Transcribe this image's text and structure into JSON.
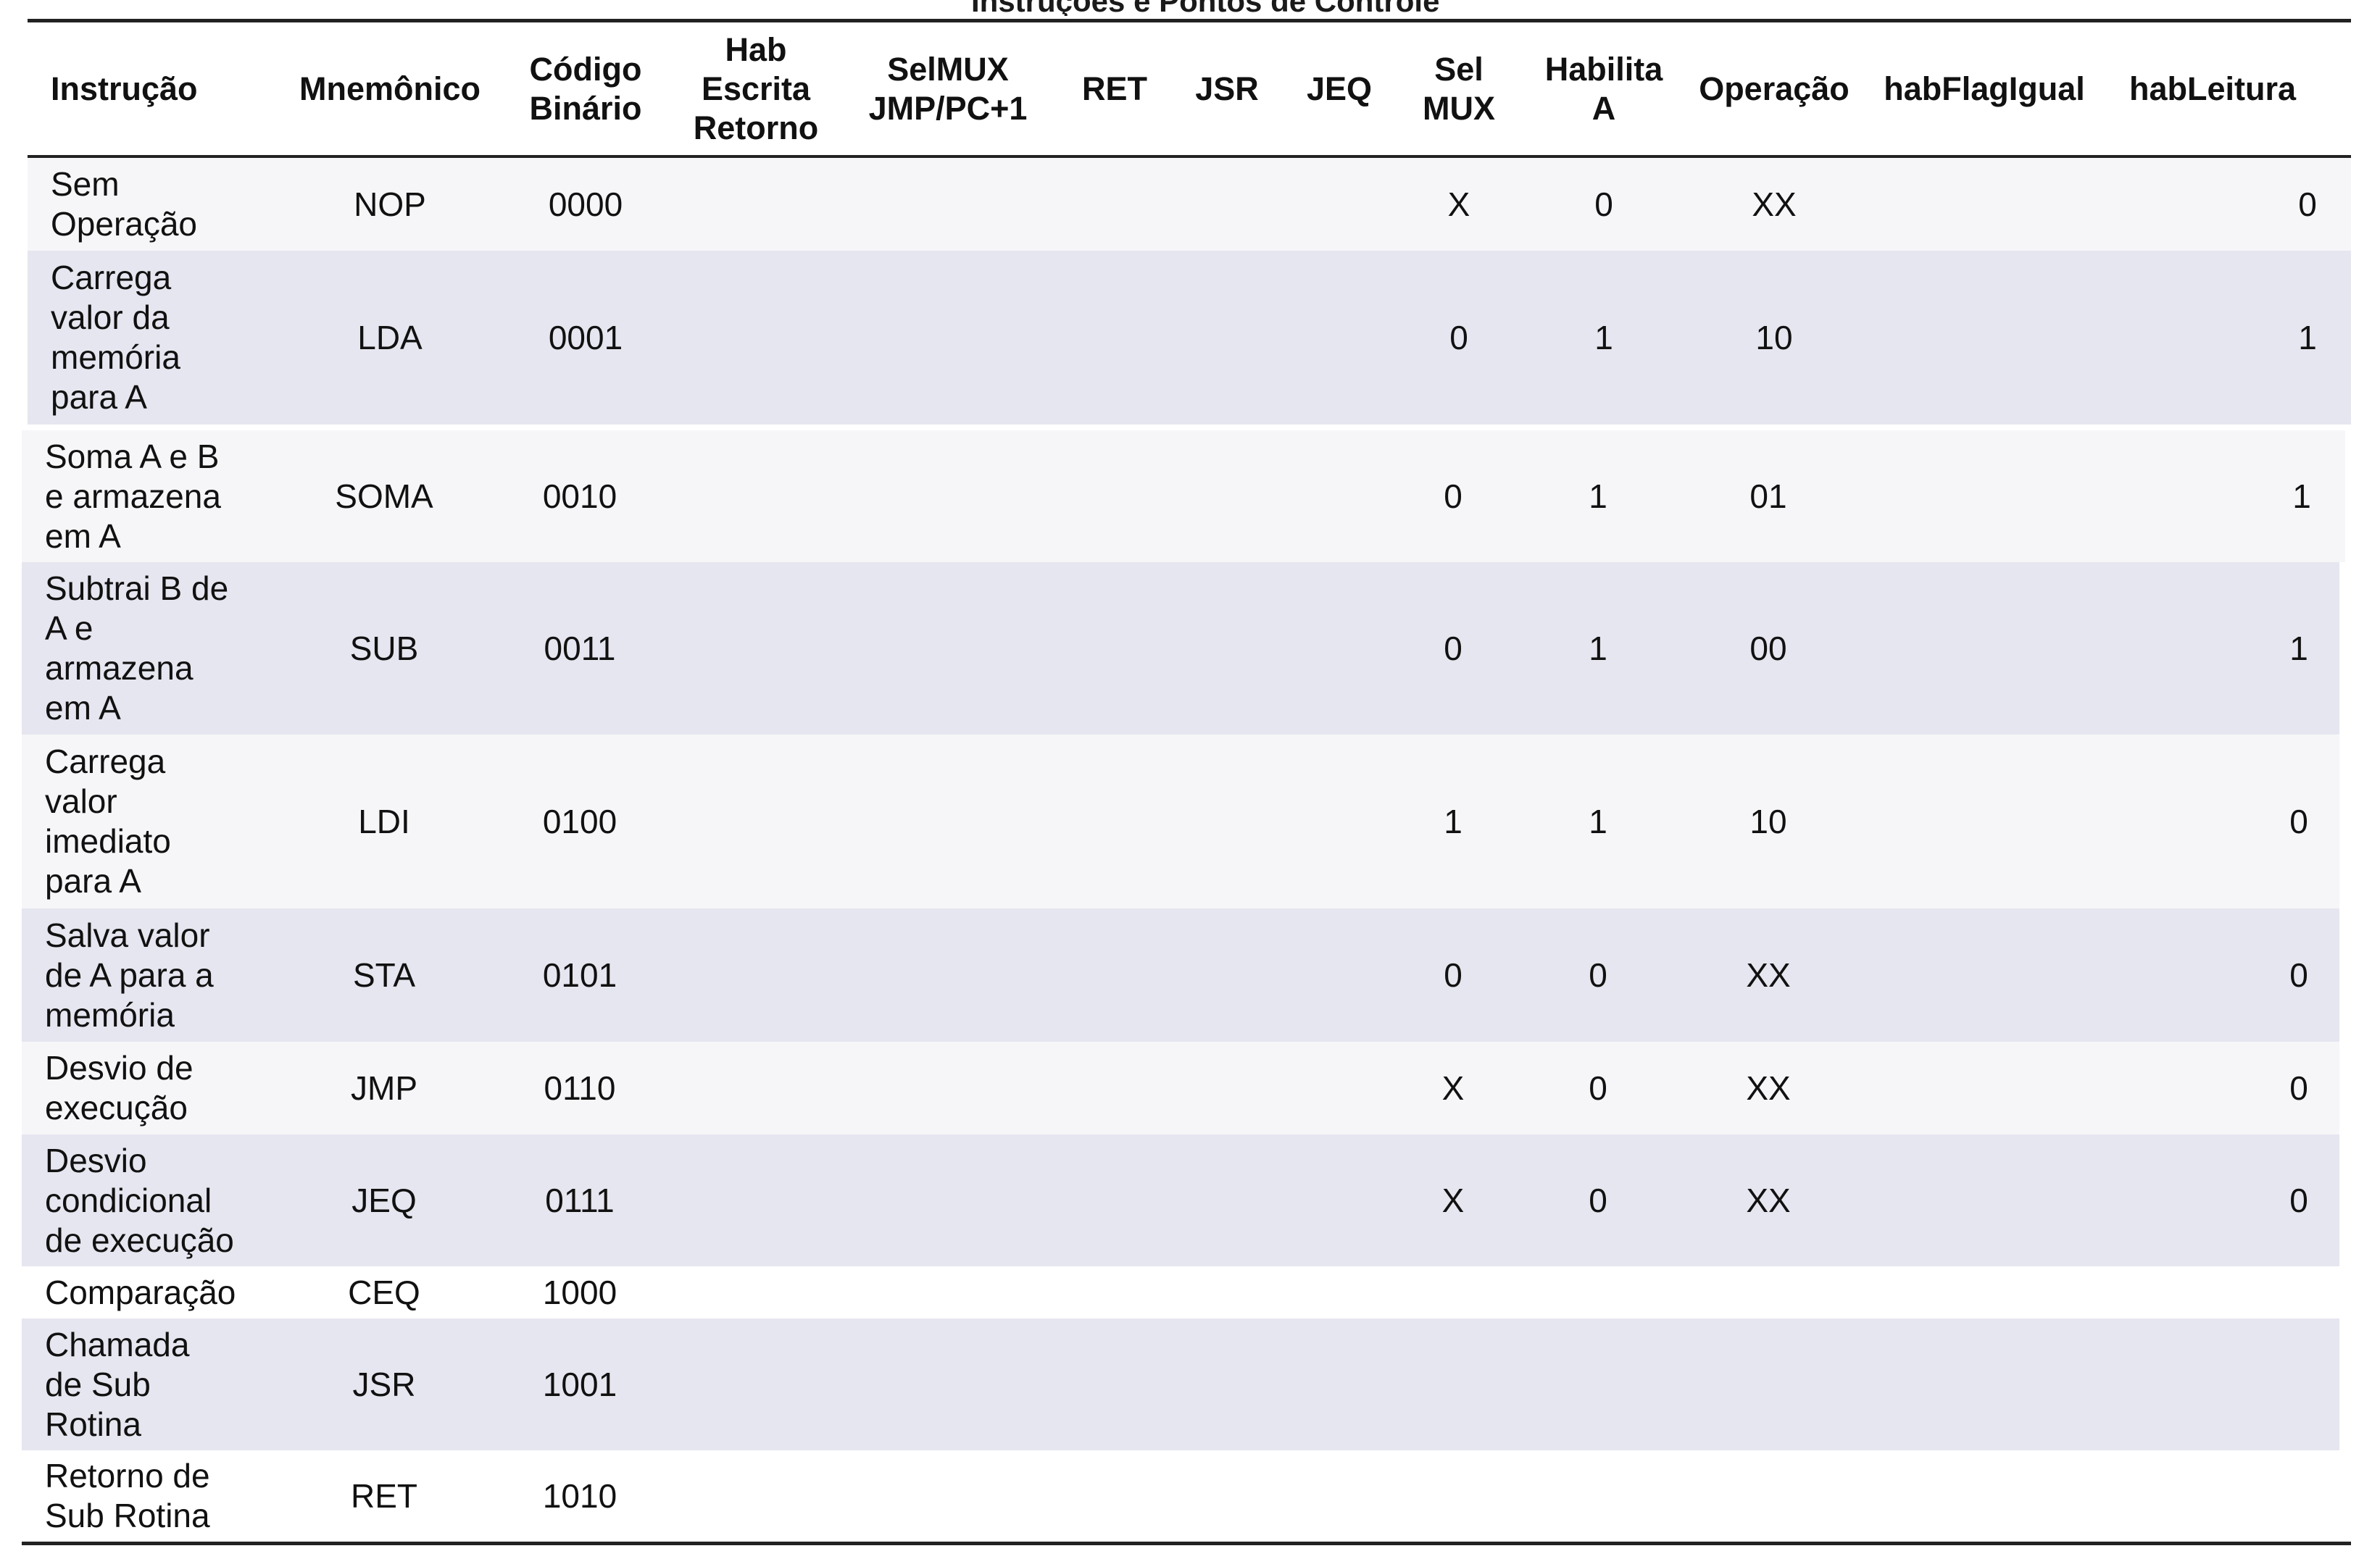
{
  "table": {
    "title": "Instruções e Pontos de Controle",
    "headers": [
      "Instrução",
      "Mnemônico",
      "Código\nBinário",
      "Hab\nEscrita\nRetorno",
      "SelMUX\nJMP/PC+1",
      "RET",
      "JSR",
      "JEQ",
      "Sel\nMUX",
      "Habilita\nA",
      "Operação",
      "habFlagIgual",
      "habLeitura"
    ],
    "rows": [
      {
        "instrucao": "Sem\nOperação",
        "mnemonico": "NOP",
        "codigo": "0000",
        "hab_escrita_retorno": "",
        "selmux_jmp": "",
        "ret": "",
        "jsr": "",
        "jeq": "",
        "sel_mux": "X",
        "habilita_a": "0",
        "operacao": "XX",
        "hab_flag_igual": "",
        "hab_leitura": "0"
      },
      {
        "instrucao": "Carrega\nvalor da\nmemória\npara A",
        "mnemonico": "LDA",
        "codigo": "0001",
        "hab_escrita_retorno": "",
        "selmux_jmp": "",
        "ret": "",
        "jsr": "",
        "jeq": "",
        "sel_mux": "0",
        "habilita_a": "1",
        "operacao": "10",
        "hab_flag_igual": "",
        "hab_leitura": "1"
      },
      {
        "instrucao": "Soma A e B\ne armazena\nem A",
        "mnemonico": "SOMA",
        "codigo": "0010",
        "hab_escrita_retorno": "",
        "selmux_jmp": "",
        "ret": "",
        "jsr": "",
        "jeq": "",
        "sel_mux": "0",
        "habilita_a": "1",
        "operacao": "01",
        "hab_flag_igual": "",
        "hab_leitura": "1"
      },
      {
        "instrucao": "Subtrai B de\nA e\narmazena\nem A",
        "mnemonico": "SUB",
        "codigo": "0011",
        "hab_escrita_retorno": "",
        "selmux_jmp": "",
        "ret": "",
        "jsr": "",
        "jeq": "",
        "sel_mux": "0",
        "habilita_a": "1",
        "operacao": "00",
        "hab_flag_igual": "",
        "hab_leitura": "1"
      },
      {
        "instrucao": "Carrega\nvalor\nimediato\npara A",
        "mnemonico": "LDI",
        "codigo": "0100",
        "hab_escrita_retorno": "",
        "selmux_jmp": "",
        "ret": "",
        "jsr": "",
        "jeq": "",
        "sel_mux": "1",
        "habilita_a": "1",
        "operacao": "10",
        "hab_flag_igual": "",
        "hab_leitura": "0"
      },
      {
        "instrucao": "Salva valor\nde A para a\nmemória",
        "mnemonico": "STA",
        "codigo": "0101",
        "hab_escrita_retorno": "",
        "selmux_jmp": "",
        "ret": "",
        "jsr": "",
        "jeq": "",
        "sel_mux": "0",
        "habilita_a": "0",
        "operacao": "XX",
        "hab_flag_igual": "",
        "hab_leitura": "0"
      },
      {
        "instrucao": "Desvio de\nexecução",
        "mnemonico": "JMP",
        "codigo": "0110",
        "hab_escrita_retorno": "",
        "selmux_jmp": "",
        "ret": "",
        "jsr": "",
        "jeq": "",
        "sel_mux": "X",
        "habilita_a": "0",
        "operacao": "XX",
        "hab_flag_igual": "",
        "hab_leitura": "0"
      },
      {
        "instrucao": "Desvio\ncondicional\nde execução",
        "mnemonico": "JEQ",
        "codigo": "0111",
        "hab_escrita_retorno": "",
        "selmux_jmp": "",
        "ret": "",
        "jsr": "",
        "jeq": "",
        "sel_mux": "X",
        "habilita_a": "0",
        "operacao": "XX",
        "hab_flag_igual": "",
        "hab_leitura": "0"
      },
      {
        "instrucao": "Comparação",
        "mnemonico": "CEQ",
        "codigo": "1000",
        "hab_escrita_retorno": "",
        "selmux_jmp": "",
        "ret": "",
        "jsr": "",
        "jeq": "",
        "sel_mux": "",
        "habilita_a": "",
        "operacao": "",
        "hab_flag_igual": "",
        "hab_leitura": ""
      },
      {
        "instrucao": "Chamada\nde Sub\nRotina",
        "mnemonico": "JSR",
        "codigo": "1001",
        "hab_escrita_retorno": "",
        "selmux_jmp": "",
        "ret": "",
        "jsr": "",
        "jeq": "",
        "sel_mux": "",
        "habilita_a": "",
        "operacao": "",
        "hab_flag_igual": "",
        "hab_leitura": ""
      },
      {
        "instrucao": "Retorno de\nSub Rotina",
        "mnemonico": "RET",
        "codigo": "1010",
        "hab_escrita_retorno": "",
        "selmux_jmp": "",
        "ret": "",
        "jsr": "",
        "jeq": "",
        "sel_mux": "",
        "habilita_a": "",
        "operacao": "",
        "hab_flag_igual": "",
        "hab_leitura": ""
      }
    ]
  }
}
